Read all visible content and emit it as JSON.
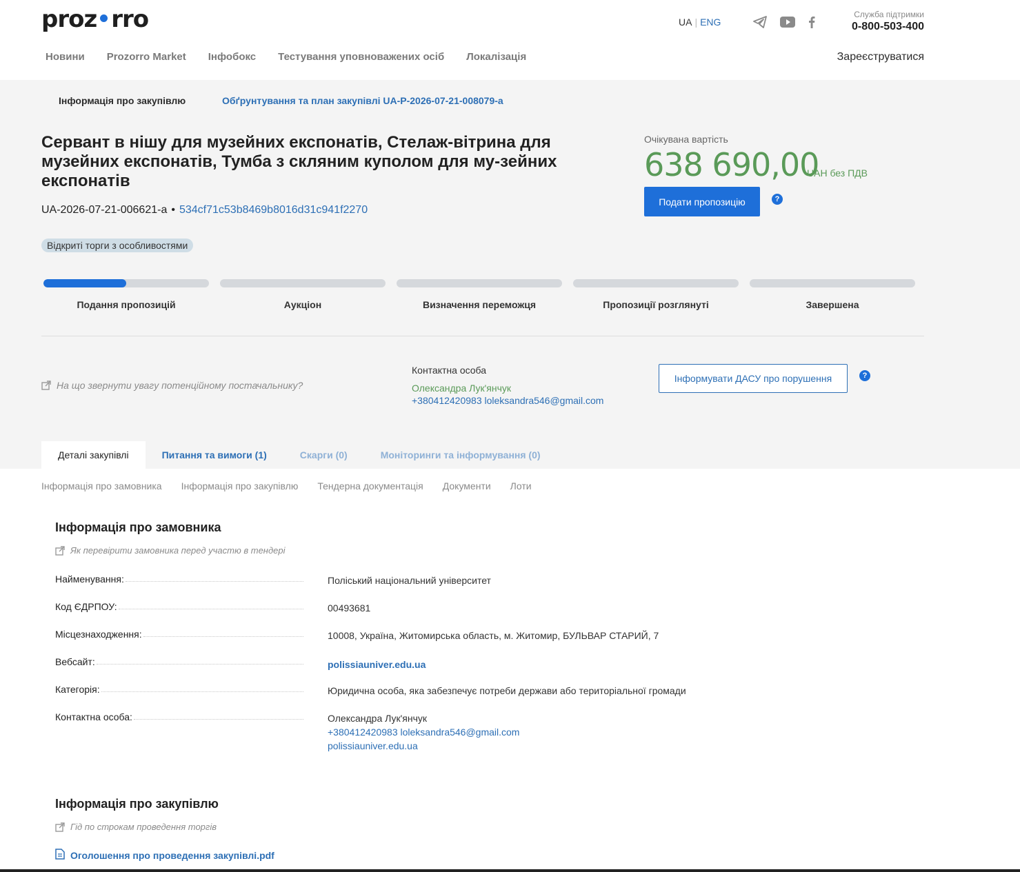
{
  "header": {
    "logo_left": "proz",
    "logo_right": "rro",
    "lang_ua": "UA",
    "lang_eng": "ENG",
    "support_label": "Служба підтримки",
    "support_phone": "0-800-503-400",
    "nav": [
      "Новини",
      "Prozorro Market",
      "Інфобокс",
      "Тестування уповноважених осіб",
      "Локалізація"
    ],
    "register": "Зареєструватися"
  },
  "breadcrumbs": {
    "active": "Інформація про закупівлю",
    "link": "Обґрунтування та план закупівлі UA-P-2026-07-21-008079-a"
  },
  "tender": {
    "title": "Сервант в нішу для музейних експонатів, Стелаж-вітрина для музейних експонатів, Тумба з скляним куполом для му-зейних експонатів",
    "id": "UA-2026-07-21-006621-a",
    "bullet": "•",
    "hash": "534cf71c53b8469b8016d31c941f2270",
    "procedure": "Відкриті торги з особливостями",
    "value_label": "Очікувана вартість",
    "value_amount": "638 690,00",
    "value_currency": "UAH без ПДВ",
    "submit_button": "Подати пропозицію",
    "help_glyph": "?"
  },
  "stages": {
    "progress": 0.5,
    "labels": [
      "Подання пропозицій",
      "Аукціон",
      "Визначення переможця",
      "Пропозиції розглянуті",
      "Завершена"
    ]
  },
  "contact": {
    "hint": "На що звернути увагу потенційному постачальнику?",
    "title": "Контактна особа",
    "name": "Олександра Лук'янчук",
    "phone_email": "+380412420983 loleksandra546@gmail.com",
    "dasu_button": "Інформувати ДАСУ про порушення"
  },
  "tabs": [
    "Деталі закупівлі",
    "Питання та вимоги (1)",
    "Скарги (0)",
    "Моніторинги та інформування (0)"
  ],
  "subnav": [
    "Інформація про замовника",
    "Інформація про закупівлю",
    "Тендерна документація",
    "Документи",
    "Лоти"
  ],
  "customer": {
    "title": "Інформація про замовника",
    "hint": "Як перевірити замовника перед участю в тендері",
    "rows": [
      {
        "key": "Найменування:",
        "value": "Поліський національний університет"
      },
      {
        "key": "Код ЄДРПОУ:",
        "value": "00493681"
      },
      {
        "key": "Місцезнаходження:",
        "value": "10008, Україна, Житомирська область, м. Житомир, БУЛЬВАР СТАРИЙ, 7"
      },
      {
        "key": "Вебсайт:",
        "value": "polissiauniver.edu.ua"
      },
      {
        "key": "Категорія:",
        "value": "Юридична особа, яка забезпечує потреби держави або територіальної громади"
      },
      {
        "key": "Контактна особа:",
        "value": "Олександра Лук'янчук",
        "line2": "+380412420983 loleksandra546@gmail.com",
        "line3": "polissiauniver.edu.ua"
      }
    ]
  },
  "procurement": {
    "title": "Інформація про закупівлю",
    "hint": "Гід по строкам проведення торгів",
    "document": "Оголошення про проведення закупівлі.pdf"
  },
  "colors": {
    "accent": "#1e6fd9",
    "link": "#2d6fb5",
    "value_green": "#5a9a58",
    "grey_bg": "#f4f4f4"
  }
}
